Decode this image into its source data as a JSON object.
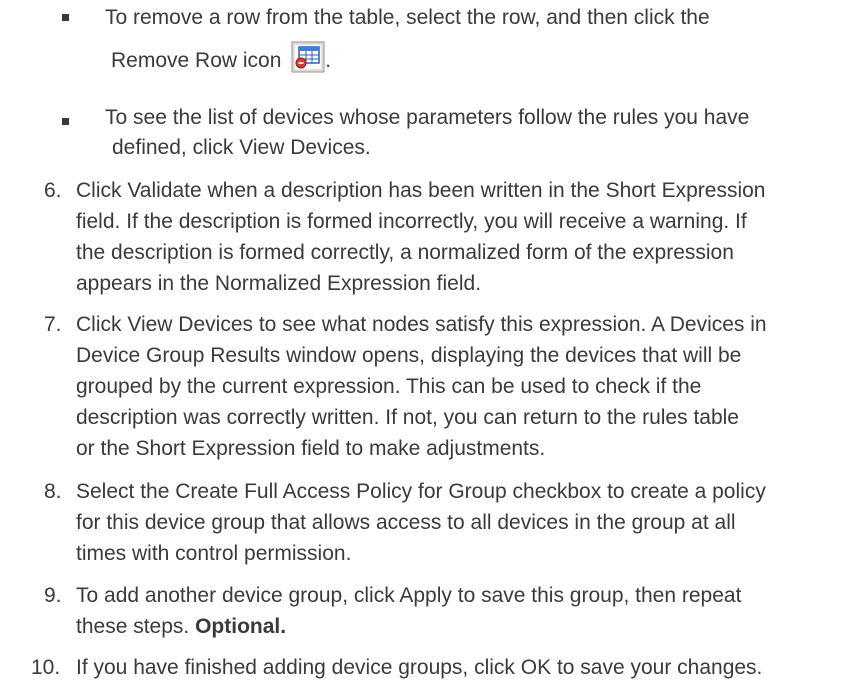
{
  "bullets": [
    {
      "lines": [
        "To remove a row from the table, select the row, and then click the",
        "Remove Row icon"
      ],
      "icon_name": "remove-row-icon",
      "trailing": "."
    },
    {
      "lines": [
        "To see the list of devices whose parameters follow the rules you have",
        "defined, click View Devices."
      ]
    }
  ],
  "steps": [
    {
      "number": "6.",
      "lines": [
        "Click Validate when a description has been written in the Short Expression",
        "field. If the description is formed incorrectly, you will receive a warning. If",
        "the description is formed correctly, a normalized form of the expression",
        "appears in the Normalized Expression field."
      ]
    },
    {
      "number": "7.",
      "lines": [
        "Click View Devices to see what nodes satisfy this expression. A Devices in",
        "Device Group Results window opens, displaying the devices that will be",
        "grouped by the current expression. This can be used to check if the",
        "description was correctly written. If not, you can return to the rules table",
        "or the Short Expression field to make adjustments."
      ]
    },
    {
      "number": "8.",
      "lines": [
        "Select the Create Full Access Policy for Group checkbox to create a policy",
        "for this device group that allows access to all devices in the group at all",
        "times with control permission."
      ]
    },
    {
      "number": "9.",
      "lines": [
        "To add another device group, click Apply to save this group, then repeat",
        "these steps."
      ],
      "bold_suffix": "Optional."
    },
    {
      "number": "10.",
      "lines": [
        "If you have finished adding device groups, click OK to save your changes."
      ]
    }
  ]
}
